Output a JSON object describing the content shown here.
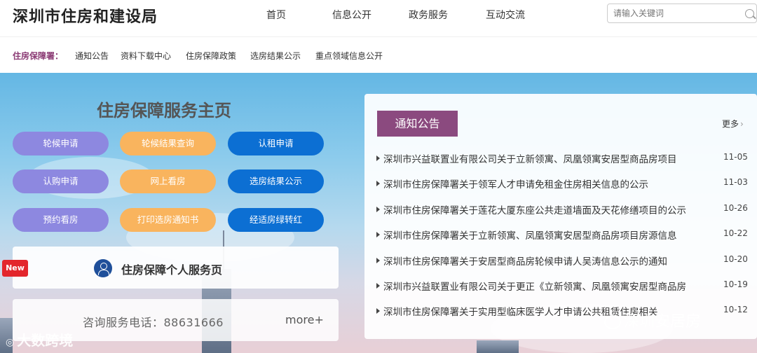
{
  "header": {
    "site_title": "深圳市住房和建设局",
    "nav": [
      "首页",
      "信息公开",
      "政务服务",
      "互动交流"
    ],
    "search_placeholder": "请输入关键词"
  },
  "subnav": {
    "label": "住房保障署：",
    "links": [
      "通知公告",
      "资料下载中心",
      "住房保障政策",
      "选房结果公示",
      "重点领域信息公开"
    ]
  },
  "hero": {
    "title": "住房保障服务主页",
    "buttons": [
      {
        "label": "轮候申请",
        "color": "#8d88e0"
      },
      {
        "label": "轮候结果查询",
        "color": "#f9b45e"
      },
      {
        "label": "认租申请",
        "color": "#0c6fd3"
      },
      {
        "label": "认购申请",
        "color": "#8d88e0"
      },
      {
        "label": "网上看房",
        "color": "#f9b45e"
      },
      {
        "label": "选房结果公示",
        "color": "#0c6fd3"
      },
      {
        "label": "预约看房",
        "color": "#8d88e0"
      },
      {
        "label": "打印选房通知书",
        "color": "#f9b45e"
      },
      {
        "label": "经适房绿转红",
        "color": "#0c6fd3"
      }
    ],
    "new_badge": "New",
    "personal_service": "住房保障个人服务页",
    "hotline": "咨询服务电话：88631666",
    "more": "more+"
  },
  "notices": {
    "tab_label": "通知公告",
    "more_label": "更多",
    "items": [
      {
        "title": "深圳市兴益联置业有限公司关于立新领寓、凤凰领寓安居型商品房项目",
        "date": "11-05"
      },
      {
        "title": "深圳市住房保障署关于领军人才申请免租金住房相关信息的公示",
        "date": "11-03"
      },
      {
        "title": "深圳市住房保障署关于莲花大厦东座公共走道墙面及天花修缮项目的公示",
        "date": "10-26"
      },
      {
        "title": "深圳市住房保障署关于立新领寓、凤凰领寓安居型商品房项目房源信息",
        "date": "10-22"
      },
      {
        "title": "深圳市住房保障署关于安居型商品房轮候申请人吴涛信息公示的通知",
        "date": "10-20"
      },
      {
        "title": "深圳市兴益联置业有限公司关于更正《立新领寓、凤凰领寓安居型商品房",
        "date": "10-19"
      },
      {
        "title": "深圳市住房保障署关于实用型临床医学人才申请公共租赁住房相关",
        "date": "10-12"
      }
    ]
  },
  "watermarks": {
    "left": "大数跨境",
    "right": "深圳安居房"
  }
}
